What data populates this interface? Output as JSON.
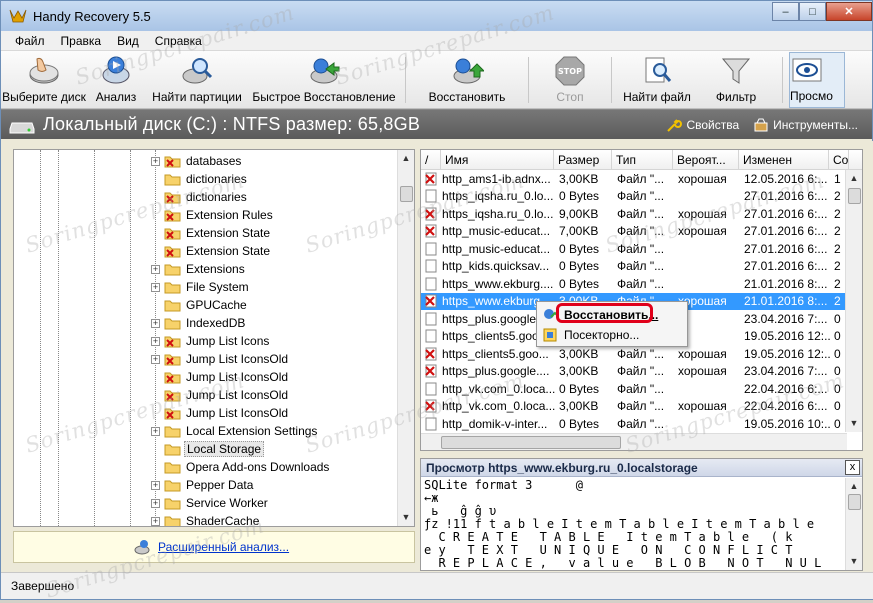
{
  "window": {
    "title": "Handy Recovery 5.5",
    "controls": {
      "minimize": "–",
      "maximize": "□",
      "close": "✕"
    }
  },
  "menu": [
    "Файл",
    "Правка",
    "Вид",
    "Справка"
  ],
  "toolbar": [
    {
      "label": "Выберите диск",
      "icon": "hand-disk-icon"
    },
    {
      "label": "Анализ",
      "icon": "analyze-icon"
    },
    {
      "label": "Найти партиции",
      "icon": "find-partitions-icon"
    },
    {
      "label": "Быстрое Восстановление",
      "icon": "quick-recovery-icon"
    },
    {
      "label": "Восстановить",
      "icon": "recover-icon"
    },
    {
      "label": "Стоп",
      "icon": "stop-icon",
      "disabled": true
    },
    {
      "label": "Найти файл",
      "icon": "find-file-icon"
    },
    {
      "label": "Фильтр",
      "icon": "filter-icon"
    },
    {
      "label": "Просмо",
      "icon": "preview-eye-icon"
    }
  ],
  "disk": {
    "title": "Локальный диск (C:) : NTFS размер: 65,8GB",
    "properties": "Свойства",
    "tools": "Инструменты..."
  },
  "tree": {
    "items": [
      {
        "label": "databases",
        "expander": "+",
        "deleted": true
      },
      {
        "label": "dictionaries",
        "expander": "",
        "deleted": false
      },
      {
        "label": "dictionaries",
        "expander": "",
        "deleted": true
      },
      {
        "label": "Extension Rules",
        "expander": "",
        "deleted": true
      },
      {
        "label": "Extension State",
        "expander": "",
        "deleted": true
      },
      {
        "label": "Extension State",
        "expander": "",
        "deleted": true
      },
      {
        "label": "Extensions",
        "expander": "+",
        "deleted": false
      },
      {
        "label": "File System",
        "expander": "+",
        "deleted": false
      },
      {
        "label": "GPUCache",
        "expander": "",
        "deleted": false
      },
      {
        "label": "IndexedDB",
        "expander": "+",
        "deleted": false
      },
      {
        "label": "Jump List Icons",
        "expander": "+",
        "deleted": true
      },
      {
        "label": "Jump List IconsOld",
        "expander": "+",
        "deleted": true
      },
      {
        "label": "Jump List IconsOld",
        "expander": "",
        "deleted": true
      },
      {
        "label": "Jump List IconsOld",
        "expander": "",
        "deleted": true
      },
      {
        "label": "Jump List IconsOld",
        "expander": "",
        "deleted": true
      },
      {
        "label": "Local Extension Settings",
        "expander": "+",
        "deleted": false
      },
      {
        "label": "Local Storage",
        "expander": "",
        "deleted": false,
        "selected": true
      },
      {
        "label": "Opera Add-ons Downloads",
        "expander": "",
        "deleted": false
      },
      {
        "label": "Pepper Data",
        "expander": "+",
        "deleted": false
      },
      {
        "label": "Service Worker",
        "expander": "+",
        "deleted": false
      },
      {
        "label": "ShaderCache",
        "expander": "+",
        "deleted": false
      }
    ],
    "advanced_link": "Расширенный анализ..."
  },
  "list": {
    "columns": [
      "/",
      "Имя",
      "Размер",
      "Тип",
      "Вероят...",
      "Изменен",
      "Со"
    ],
    "rows": [
      {
        "name": "http_ams1-ib.adnx...",
        "size": "3,00KB",
        "type": "Файл \"...",
        "prob": "хорошая",
        "modified": "12.05.2016 6:...",
        "co": "1",
        "deleted": true
      },
      {
        "name": "https_iqsha.ru_0.lo...",
        "size": "0 Bytes",
        "type": "Файл \"...",
        "prob": "",
        "modified": "27.01.2016 6:...",
        "co": "2",
        "deleted": false
      },
      {
        "name": "https_iqsha.ru_0.lo...",
        "size": "9,00KB",
        "type": "Файл \"...",
        "prob": "хорошая",
        "modified": "27.01.2016 6:...",
        "co": "2",
        "deleted": true
      },
      {
        "name": "http_music-educat...",
        "size": "7,00KB",
        "type": "Файл \"...",
        "prob": "хорошая",
        "modified": "27.01.2016 6:...",
        "co": "2",
        "deleted": true
      },
      {
        "name": "http_music-educat...",
        "size": "0 Bytes",
        "type": "Файл \"...",
        "prob": "",
        "modified": "27.01.2016 6:...",
        "co": "2",
        "deleted": false
      },
      {
        "name": "http_kids.quicksav...",
        "size": "0 Bytes",
        "type": "Файл \"...",
        "prob": "",
        "modified": "27.01.2016 6:...",
        "co": "2",
        "deleted": false
      },
      {
        "name": "https_www.ekburg....",
        "size": "0 Bytes",
        "type": "Файл \"...",
        "prob": "",
        "modified": "21.01.2016 8:...",
        "co": "2",
        "deleted": false
      },
      {
        "name": "https_www.ekburg....",
        "size": "3,00KB",
        "type": "Файл \"...",
        "prob": "хорошая",
        "modified": "21.01.2016 8:...",
        "co": "2",
        "deleted": true,
        "selected": true
      },
      {
        "name": "https_plus.google",
        "size": "",
        "type": "",
        "prob": "",
        "modified": "23.04.2016 7:...",
        "co": "0",
        "deleted": false
      },
      {
        "name": "https_clients5.goo",
        "size": "",
        "type": "",
        "prob": "",
        "modified": "19.05.2016 12:...",
        "co": "0",
        "deleted": false
      },
      {
        "name": "https_clients5.goo...",
        "size": "3,00KB",
        "type": "Файл \"...",
        "prob": "хорошая",
        "modified": "19.05.2016 12:...",
        "co": "0",
        "deleted": true
      },
      {
        "name": "https_plus.google....",
        "size": "3,00KB",
        "type": "Файл \"...",
        "prob": "хорошая",
        "modified": "23.04.2016 7:...",
        "co": "0",
        "deleted": true
      },
      {
        "name": "http_vk.com_0.loca...",
        "size": "0 Bytes",
        "type": "Файл \"...",
        "prob": "",
        "modified": "22.04.2016 6:...",
        "co": "0",
        "deleted": false
      },
      {
        "name": "http_vk.com_0.loca...",
        "size": "3,00KB",
        "type": "Файл \"...",
        "prob": "хорошая",
        "modified": "22.04.2016 6:...",
        "co": "0",
        "deleted": true
      },
      {
        "name": "http_domik-v-inter...",
        "size": "0 Bytes",
        "type": "Файл \"...",
        "prob": "",
        "modified": "19.05.2016 10:...",
        "co": "0",
        "deleted": false
      }
    ]
  },
  "context_menu": {
    "items": [
      "Восстановить...",
      "Посекторно..."
    ]
  },
  "preview": {
    "title": "Просмотр https_www.ekburg.ru_0.localstorage",
    "close": "x",
    "lines": [
      "SQLite format 3      @",
      "←ж",
      " ь   ĝ ĝ υ",
      "ƒz !11 f t a b l e I t e m T a b l e I t e m T a b l e",
      "  C R E A T E   T A B L E   I t e m T a b l e   ( k",
      "e y   T E X T   U N I Q U E   O N   C O N F L I C T",
      "  R E P L A C E ,   v a l u e   B L O B   N O T   N U L"
    ]
  },
  "status": "Завершено",
  "watermark": "Soringpcrepair.com",
  "colors": {
    "selection": "#3399ff",
    "highlight_ring": "#e0001a",
    "link": "#0033cc"
  }
}
